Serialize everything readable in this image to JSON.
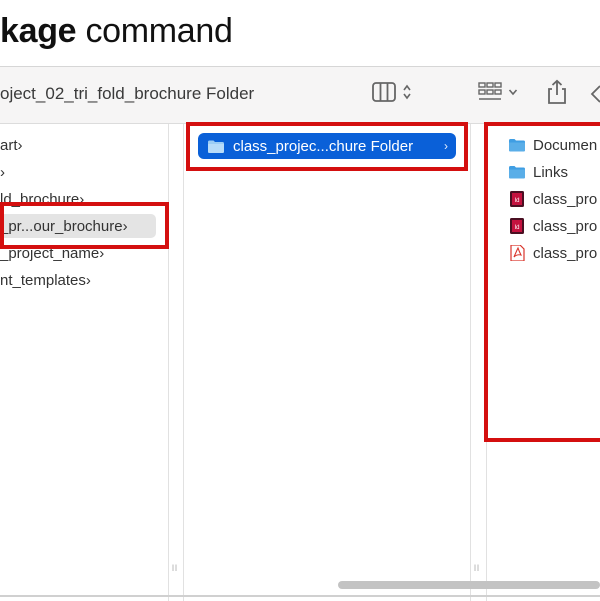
{
  "heading": {
    "bold": "kage",
    "rest": " command"
  },
  "window": {
    "title": "oject_02_tri_fold_brochure Folder"
  },
  "toolbar": {
    "view_icon": "column-view-icon",
    "group_icon": "group-grid-icon",
    "share_icon": "share-icon",
    "tag_icon": "tag-icon"
  },
  "column1": {
    "items": [
      {
        "label": "art"
      },
      {
        "label": ""
      },
      {
        "label": "ld_brochure"
      },
      {
        "label": "_pr...our_brochure"
      },
      {
        "label": "_project_name"
      },
      {
        "label": "nt_templates"
      }
    ]
  },
  "column2": {
    "selected": {
      "label": "class_projec...chure Folder"
    }
  },
  "column3": {
    "items": [
      {
        "label": "Documen",
        "icon": "folder-icon"
      },
      {
        "label": "Links",
        "icon": "folder-icon"
      },
      {
        "label": "class_pro",
        "icon": "indesign-file-icon"
      },
      {
        "label": "class_pro",
        "icon": "indesign-file-icon"
      },
      {
        "label": "class_pro",
        "icon": "pdf-file-icon"
      }
    ]
  },
  "colors": {
    "highlight_red": "#d40f0f",
    "selection_blue": "#0a60d8",
    "folder_blue": "#5aaee8",
    "indesign_red": "#c4123f",
    "pdf_red": "#d9342b"
  }
}
